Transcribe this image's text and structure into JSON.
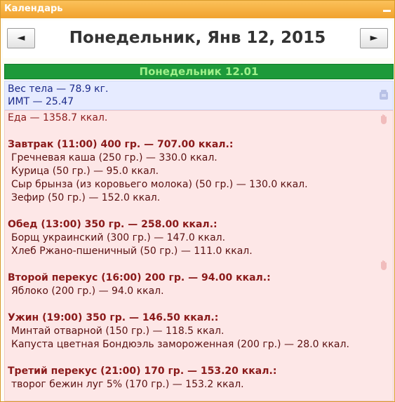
{
  "window": {
    "title": "Календарь"
  },
  "nav": {
    "prev": "◄",
    "next": "►",
    "date": "Понедельник, Янв 12, 2015"
  },
  "day_header": "Понедельник 12.01",
  "weight": {
    "line1": "Вес тела — 78.9 кг.",
    "line2": "ИМТ — 25.47"
  },
  "food": {
    "total": "Еда — 1358.7 ккал.",
    "meals": [
      {
        "title": "Завтрак (11:00) 400 гр. — 707.00 ккал.:",
        "items": [
          "Гречневая каша (250 гр.) — 330.0 ккал.",
          "Курица (50 гр.) — 95.0 ккал.",
          "Сыр брынза (из коровьего молока) (50 гр.) — 130.0 ккал.",
          "Зефир (50 гр.) — 152.0 ккал."
        ]
      },
      {
        "title": "Обед (13:00) 350 гр. — 258.00 ккал.:",
        "items": [
          "Борщ украинский (300 гр.) — 147.0 ккал.",
          "Хлеб Ржано-пшеничный (50 гр.) — 111.0 ккал."
        ]
      },
      {
        "title": "Второй перекус (16:00) 200 гр. — 94.00 ккал.:",
        "items": [
          "Яблоко (200 гр.) — 94.0 ккал."
        ]
      },
      {
        "title": "Ужин (19:00) 350 гр. — 146.50 ккал.:",
        "items": [
          "Минтай отварной (150 гр.) — 118.5 ккал.",
          "Капуста цветная Бондюэль замороженная (200 гр.) — 28.0 ккал."
        ]
      },
      {
        "title": "Третий перекус (21:00) 170 гр. — 153.20 ккал.:",
        "items": [
          "творог бежин луг 5% (170 гр.) — 153.2 ккал."
        ]
      }
    ]
  }
}
